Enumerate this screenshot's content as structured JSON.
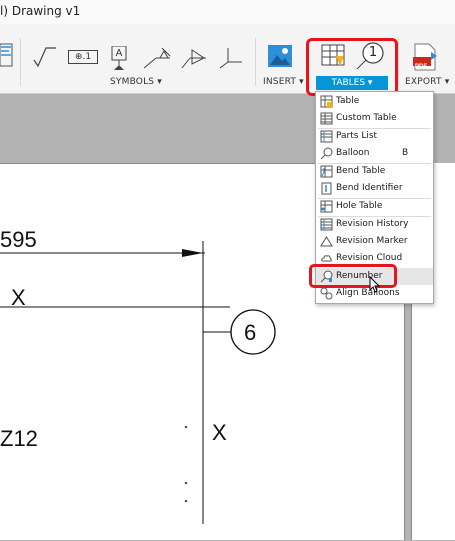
{
  "window": {
    "title": "l) Drawing v1"
  },
  "ribbon": {
    "groups": {
      "symbols_label": "SYMBOLS ▾",
      "insert_label": "INSERT ▾",
      "tables_label": "TABLES ▾",
      "export_label": "EXPORT ▾"
    },
    "balloon_tool_text": "1",
    "datum_tool_text": "A",
    "feature_frame_text": "⊕.1",
    "pdf_text": "PDF"
  },
  "tables_menu": {
    "items": [
      {
        "label": "Table",
        "icon": "table-icon"
      },
      {
        "label": "Custom Table",
        "icon": "custom-table-icon"
      },
      {
        "label": "Parts List",
        "icon": "parts-list-icon"
      },
      {
        "label": "Balloon",
        "icon": "balloon-icon",
        "shortcut": "B"
      },
      {
        "label": "Bend Table",
        "icon": "bend-table-icon"
      },
      {
        "label": "Bend Identifier",
        "icon": "bend-identifier-icon"
      },
      {
        "label": "Hole Table",
        "icon": "hole-table-icon"
      },
      {
        "label": "Revision History",
        "icon": "revision-history-icon"
      },
      {
        "label": "Revision Marker",
        "icon": "revision-marker-icon"
      },
      {
        "label": "Revision Cloud",
        "icon": "revision-cloud-icon"
      },
      {
        "label": "Renumber",
        "icon": "renumber-icon"
      },
      {
        "label": "Align Balloons",
        "icon": "align-balloons-icon"
      }
    ],
    "hovered": "Renumber"
  },
  "drawing": {
    "dimension_text": "595",
    "x_label_top": "X",
    "balloon_number": "6",
    "z_label": "Z12",
    "x_label_right": "X"
  },
  "colors": {
    "accent": "#0696d7",
    "highlight": "#e8141c"
  }
}
